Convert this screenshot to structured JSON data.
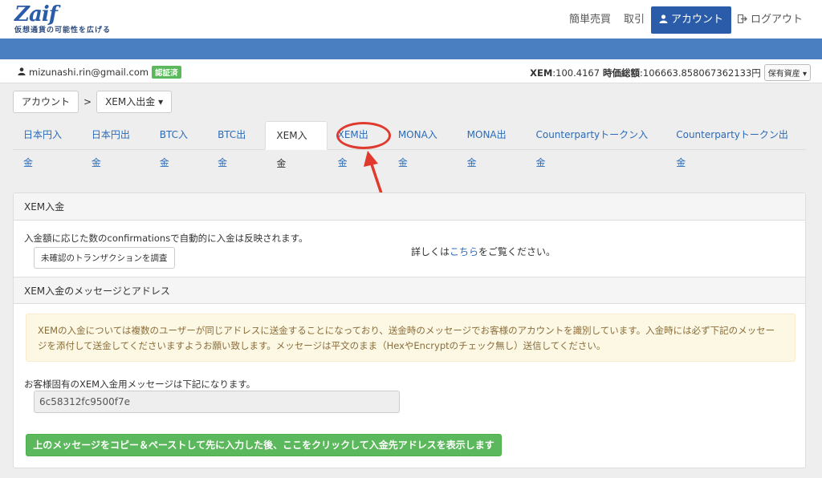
{
  "brand": {
    "logo": "Zaif",
    "tagline": "仮想通貨の可能性を広げる"
  },
  "nav": {
    "items": [
      {
        "label": "簡単売買"
      },
      {
        "label": "取引"
      },
      {
        "label": "アカウント",
        "active": true
      },
      {
        "label": "ログアウト"
      }
    ]
  },
  "user": {
    "email": "mizunashi.rin@gmail.com",
    "verified_badge": "認証済",
    "currency": "XEM",
    "balance": "100.4167",
    "total_label": "時価総額",
    "total_value": "106663.858067362133円",
    "assets_button": "保有資産"
  },
  "breadcrumb": {
    "root": "アカウント",
    "sep": ">",
    "current": "XEM入出金"
  },
  "tabs": [
    "日本円入金",
    "日本円出金",
    "BTC入金",
    "BTC出金",
    "XEM入金",
    "XEM出金",
    "MONA入金",
    "MONA出金",
    "Counterpartyトークン入金",
    "Counterpartyトークン出金"
  ],
  "panel": {
    "title": "XEM入金",
    "description": "入金額に応じた数のconfirmationsで自動的に入金は反映されます。",
    "check_button": "未確認のトランザクションを調査",
    "detail_prefix": "詳しくは",
    "detail_link": "こちら",
    "detail_suffix": "をご覧ください。",
    "section_title": "XEM入金のメッセージとアドレス",
    "warning": "XEMの入金については複数のユーザーが同じアドレスに送金することになっており、送金時のメッセージでお客様のアカウントを識別しています。入金時には必ず下記のメッセージを添付して送金してくださいますようお願い致します。メッセージは平文のまま（HexやEncryptのチェック無し）送信してください。",
    "message_label": "お客様固有のXEM入金用メッセージは下記になります。",
    "message_value": "6c58312fc9500f7e",
    "show_address_button": "上のメッセージをコピー＆ペーストして先に入力した後、ここをクリックして入金先アドレスを表示します"
  },
  "colors": {
    "brand": "#2a5caa",
    "accent_bar": "#4a7fc1",
    "success": "#5cb85c",
    "annotation": "#e03a2f"
  }
}
